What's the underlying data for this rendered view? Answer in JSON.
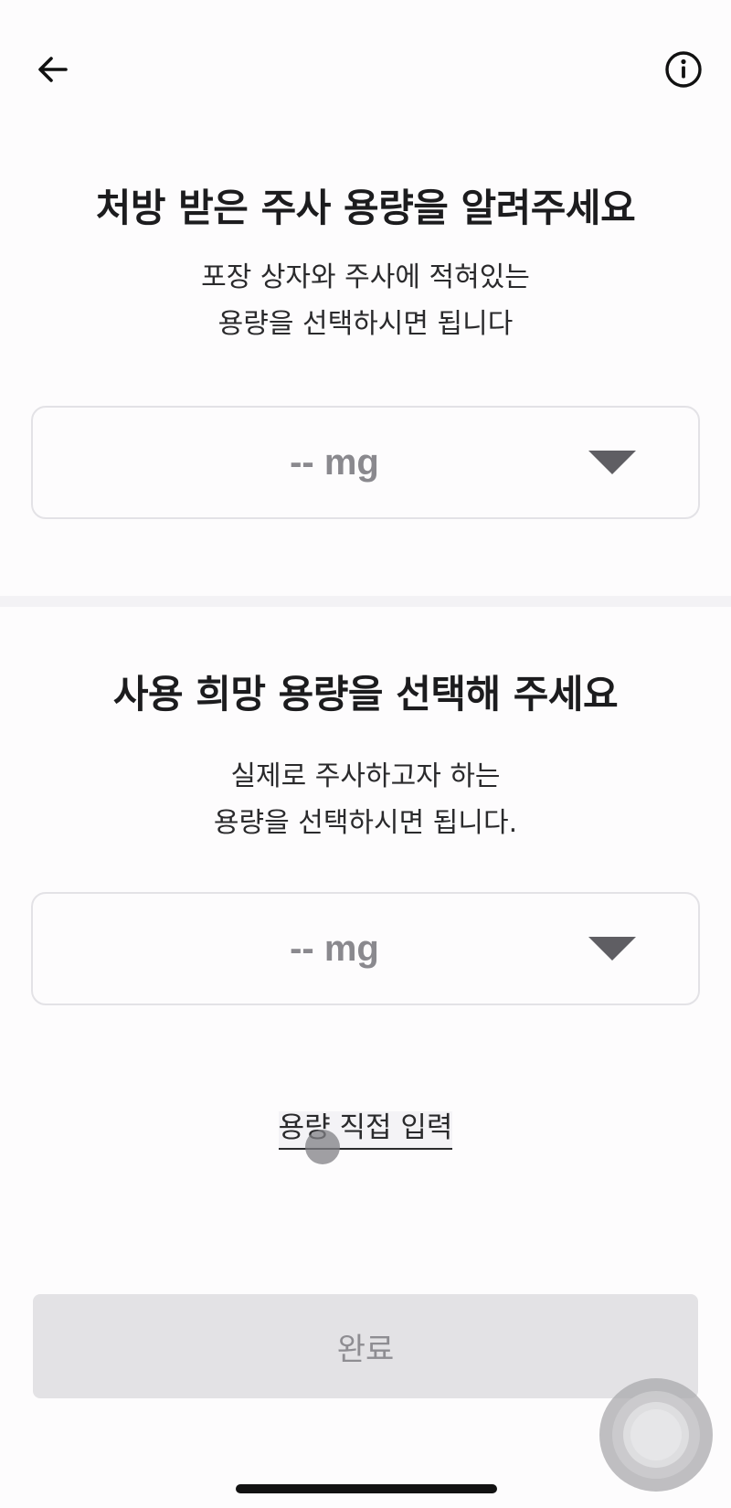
{
  "header": {
    "back_icon": "arrow-left-icon",
    "info_icon": "info-circle-icon"
  },
  "prescribed": {
    "title": "처방 받은 주사 용량을 알려주세요",
    "desc_line1": "포장 상자와 주사에 적혀있는",
    "desc_line2": "용량을 선택하시면 됩니다",
    "select_value": "-- mg",
    "caret_icon": "caret-down-icon"
  },
  "desired": {
    "title": "사용 희망 용량을 선택해 주세요",
    "desc_line1": "실제로 주사하고자 하는",
    "desc_line2": "용량을 선택하시면 됩니다.",
    "select_value": "-- mg",
    "caret_icon": "caret-down-icon"
  },
  "manual_entry_label": "용량 직접 입력",
  "done_label": "완료",
  "colors": {
    "background": "#fdfcfd",
    "text_primary": "#1c1c1e",
    "placeholder": "#8a898e",
    "disabled_button": "#e3e2e5",
    "disabled_text": "#8e8d92"
  }
}
